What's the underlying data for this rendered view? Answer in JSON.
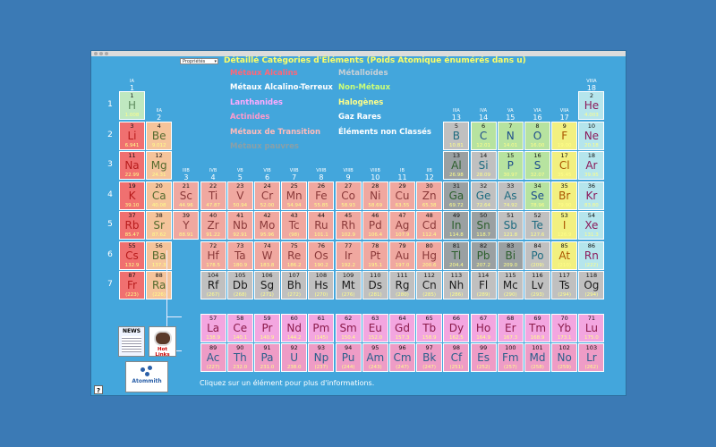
{
  "dropdown": {
    "value": "Propriétés"
  },
  "title": "Détaillé Catégories d'Éléments (Poids Atomique énumérés dans u)",
  "legend": [
    {
      "label": "Métaux Alcalins",
      "color": "#ff6677"
    },
    {
      "label": "Métaux Alcalino-Terreux",
      "color": "#ffffff"
    },
    {
      "label": "Lanthanides",
      "color": "#ffaaff"
    },
    {
      "label": "Actinides",
      "color": "#ff99cc"
    },
    {
      "label": "Métaux de Transition",
      "color": "#ffbbbb"
    },
    {
      "label": "Métaux pauvres",
      "color": "#8aa0a8"
    },
    {
      "label": "Métalloïdes",
      "color": "#c8d0d6"
    },
    {
      "label": "Non-Métaux",
      "color": "#ccff77"
    },
    {
      "label": "Halogènes",
      "color": "#ffff88"
    },
    {
      "label": "Gaz Rares",
      "color": "#ffffff"
    },
    {
      "label": "Éléments non Classés",
      "color": "#ffffff"
    }
  ],
  "groups": [
    {
      "roman": "IA",
      "arabic": "1"
    },
    {
      "roman": "IIA",
      "arabic": "2"
    },
    {
      "roman": "IIIB",
      "arabic": "3"
    },
    {
      "roman": "IVB",
      "arabic": "4"
    },
    {
      "roman": "VB",
      "arabic": "5"
    },
    {
      "roman": "VIB",
      "arabic": "6"
    },
    {
      "roman": "VIIB",
      "arabic": "7"
    },
    {
      "roman": "VIIIB",
      "arabic": "8"
    },
    {
      "roman": "VIIIB",
      "arabic": "9"
    },
    {
      "roman": "VIIIB",
      "arabic": "10"
    },
    {
      "roman": "IB",
      "arabic": "11"
    },
    {
      "roman": "IIB",
      "arabic": "12"
    },
    {
      "roman": "IIIA",
      "arabic": "13"
    },
    {
      "roman": "IVA",
      "arabic": "14"
    },
    {
      "roman": "VA",
      "arabic": "15"
    },
    {
      "roman": "VIA",
      "arabic": "16"
    },
    {
      "roman": "VIIA",
      "arabic": "17"
    },
    {
      "roman": "VIIIA",
      "arabic": "18"
    }
  ],
  "periods": [
    "1",
    "2",
    "3",
    "4",
    "5",
    "6",
    "7"
  ],
  "categories": {
    "alkali": {
      "bg": "#f07070",
      "fg": "#b71c1c"
    },
    "alkaline": {
      "bg": "#f5c49b",
      "fg": "#556b2f"
    },
    "transition": {
      "bg": "#f0a8a0",
      "fg": "#8b3a3a"
    },
    "poor": {
      "bg": "#9aa0a2",
      "fg": "#2e5f2e"
    },
    "metalloid": {
      "bg": "#c0c0c0",
      "fg": "#1e6b80"
    },
    "nonmetal": {
      "bg": "#b7e3a0",
      "fg": "#1e4d8c"
    },
    "halogen": {
      "bg": "#f2f080",
      "fg": "#aa5500"
    },
    "noble": {
      "bg": "#b5e5ec",
      "fg": "#8b1a5a"
    },
    "lanthanide": {
      "bg": "#f3a6e0",
      "fg": "#8b1a4a"
    },
    "actinide": {
      "bg": "#ee9cc6",
      "fg": "#2a5f8b"
    },
    "unknown": {
      "bg": "#c0c0c0",
      "fg": "#1c1c1c"
    },
    "hydrogen": {
      "bg": "#bfe8c0",
      "fg": "#5e8c5e"
    }
  },
  "elements": [
    {
      "z": "1",
      "s": "H",
      "w": "1.008",
      "c": "hydrogen",
      "p": 1,
      "g": 1
    },
    {
      "z": "2",
      "s": "He",
      "w": "4.003",
      "c": "noble",
      "p": 1,
      "g": 18
    },
    {
      "z": "3",
      "s": "Li",
      "w": "6.941",
      "c": "alkali",
      "p": 2,
      "g": 1
    },
    {
      "z": "4",
      "s": "Be",
      "w": "9.012",
      "c": "alkaline",
      "p": 2,
      "g": 2
    },
    {
      "z": "5",
      "s": "B",
      "w": "10.81",
      "c": "metalloid",
      "p": 2,
      "g": 13
    },
    {
      "z": "6",
      "s": "C",
      "w": "12.01",
      "c": "nonmetal",
      "p": 2,
      "g": 14
    },
    {
      "z": "7",
      "s": "N",
      "w": "14.01",
      "c": "nonmetal",
      "p": 2,
      "g": 15
    },
    {
      "z": "8",
      "s": "O",
      "w": "16.00",
      "c": "nonmetal",
      "p": 2,
      "g": 16
    },
    {
      "z": "9",
      "s": "F",
      "w": "19.00",
      "c": "halogen",
      "p": 2,
      "g": 17
    },
    {
      "z": "10",
      "s": "Ne",
      "w": "20.18",
      "c": "noble",
      "p": 2,
      "g": 18
    },
    {
      "z": "11",
      "s": "Na",
      "w": "22.99",
      "c": "alkali",
      "p": 3,
      "g": 1
    },
    {
      "z": "12",
      "s": "Mg",
      "w": "24.31",
      "c": "alkaline",
      "p": 3,
      "g": 2
    },
    {
      "z": "13",
      "s": "Al",
      "w": "26.98",
      "c": "poor",
      "p": 3,
      "g": 13
    },
    {
      "z": "14",
      "s": "Si",
      "w": "28.09",
      "c": "metalloid",
      "p": 3,
      "g": 14
    },
    {
      "z": "15",
      "s": "P",
      "w": "30.97",
      "c": "nonmetal",
      "p": 3,
      "g": 15
    },
    {
      "z": "16",
      "s": "S",
      "w": "32.07",
      "c": "nonmetal",
      "p": 3,
      "g": 16
    },
    {
      "z": "17",
      "s": "Cl",
      "w": "35.45",
      "c": "halogen",
      "p": 3,
      "g": 17
    },
    {
      "z": "18",
      "s": "Ar",
      "w": "39.95",
      "c": "noble",
      "p": 3,
      "g": 18
    },
    {
      "z": "19",
      "s": "K",
      "w": "39.10",
      "c": "alkali",
      "p": 4,
      "g": 1
    },
    {
      "z": "20",
      "s": "Ca",
      "w": "40.08",
      "c": "alkaline",
      "p": 4,
      "g": 2
    },
    {
      "z": "21",
      "s": "Sc",
      "w": "44.96",
      "c": "transition",
      "p": 4,
      "g": 3
    },
    {
      "z": "22",
      "s": "Ti",
      "w": "47.87",
      "c": "transition",
      "p": 4,
      "g": 4
    },
    {
      "z": "23",
      "s": "V",
      "w": "50.94",
      "c": "transition",
      "p": 4,
      "g": 5
    },
    {
      "z": "24",
      "s": "Cr",
      "w": "52.00",
      "c": "transition",
      "p": 4,
      "g": 6
    },
    {
      "z": "25",
      "s": "Mn",
      "w": "54.94",
      "c": "transition",
      "p": 4,
      "g": 7
    },
    {
      "z": "26",
      "s": "Fe",
      "w": "55.85",
      "c": "transition",
      "p": 4,
      "g": 8
    },
    {
      "z": "27",
      "s": "Co",
      "w": "58.93",
      "c": "transition",
      "p": 4,
      "g": 9
    },
    {
      "z": "28",
      "s": "Ni",
      "w": "58.69",
      "c": "transition",
      "p": 4,
      "g": 10
    },
    {
      "z": "29",
      "s": "Cu",
      "w": "63.55",
      "c": "transition",
      "p": 4,
      "g": 11
    },
    {
      "z": "30",
      "s": "Zn",
      "w": "65.38",
      "c": "transition",
      "p": 4,
      "g": 12
    },
    {
      "z": "31",
      "s": "Ga",
      "w": "69.72",
      "c": "poor",
      "p": 4,
      "g": 13
    },
    {
      "z": "32",
      "s": "Ge",
      "w": "72.64",
      "c": "metalloid",
      "p": 4,
      "g": 14
    },
    {
      "z": "33",
      "s": "As",
      "w": "74.92",
      "c": "metalloid",
      "p": 4,
      "g": 15
    },
    {
      "z": "34",
      "s": "Se",
      "w": "78.96",
      "c": "nonmetal",
      "p": 4,
      "g": 16
    },
    {
      "z": "35",
      "s": "Br",
      "w": "79.90",
      "c": "halogen",
      "p": 4,
      "g": 17
    },
    {
      "z": "36",
      "s": "Kr",
      "w": "83.80",
      "c": "noble",
      "p": 4,
      "g": 18
    },
    {
      "z": "37",
      "s": "Rb",
      "w": "85.47",
      "c": "alkali",
      "p": 5,
      "g": 1
    },
    {
      "z": "38",
      "s": "Sr",
      "w": "87.62",
      "c": "alkaline",
      "p": 5,
      "g": 2
    },
    {
      "z": "39",
      "s": "Y",
      "w": "88.91",
      "c": "transition",
      "p": 5,
      "g": 3
    },
    {
      "z": "40",
      "s": "Zr",
      "w": "91.22",
      "c": "transition",
      "p": 5,
      "g": 4
    },
    {
      "z": "41",
      "s": "Nb",
      "w": "92.91",
      "c": "transition",
      "p": 5,
      "g": 5
    },
    {
      "z": "42",
      "s": "Mo",
      "w": "95.96",
      "c": "transition",
      "p": 5,
      "g": 6
    },
    {
      "z": "43",
      "s": "Tc",
      "w": "(98)",
      "c": "transition",
      "p": 5,
      "g": 7
    },
    {
      "z": "44",
      "s": "Ru",
      "w": "101.1",
      "c": "transition",
      "p": 5,
      "g": 8
    },
    {
      "z": "45",
      "s": "Rh",
      "w": "102.9",
      "c": "transition",
      "p": 5,
      "g": 9
    },
    {
      "z": "46",
      "s": "Pd",
      "w": "106.4",
      "c": "transition",
      "p": 5,
      "g": 10
    },
    {
      "z": "47",
      "s": "Ag",
      "w": "107.9",
      "c": "transition",
      "p": 5,
      "g": 11
    },
    {
      "z": "48",
      "s": "Cd",
      "w": "112.4",
      "c": "transition",
      "p": 5,
      "g": 12
    },
    {
      "z": "49",
      "s": "In",
      "w": "114.8",
      "c": "poor",
      "p": 5,
      "g": 13
    },
    {
      "z": "50",
      "s": "Sn",
      "w": "118.7",
      "c": "poor",
      "p": 5,
      "g": 14
    },
    {
      "z": "51",
      "s": "Sb",
      "w": "121.8",
      "c": "metalloid",
      "p": 5,
      "g": 15
    },
    {
      "z": "52",
      "s": "Te",
      "w": "127.6",
      "c": "metalloid",
      "p": 5,
      "g": 16
    },
    {
      "z": "53",
      "s": "I",
      "w": "126.9",
      "c": "halogen",
      "p": 5,
      "g": 17
    },
    {
      "z": "54",
      "s": "Xe",
      "w": "131.3",
      "c": "noble",
      "p": 5,
      "g": 18
    },
    {
      "z": "55",
      "s": "Cs",
      "w": "132.9",
      "c": "alkali",
      "p": 6,
      "g": 1
    },
    {
      "z": "56",
      "s": "Ba",
      "w": "137.3",
      "c": "alkaline",
      "p": 6,
      "g": 2
    },
    {
      "z": "72",
      "s": "Hf",
      "w": "178.5",
      "c": "transition",
      "p": 6,
      "g": 4
    },
    {
      "z": "73",
      "s": "Ta",
      "w": "180.9",
      "c": "transition",
      "p": 6,
      "g": 5
    },
    {
      "z": "74",
      "s": "W",
      "w": "183.8",
      "c": "transition",
      "p": 6,
      "g": 6
    },
    {
      "z": "75",
      "s": "Re",
      "w": "186.2",
      "c": "transition",
      "p": 6,
      "g": 7
    },
    {
      "z": "76",
      "s": "Os",
      "w": "190.2",
      "c": "transition",
      "p": 6,
      "g": 8
    },
    {
      "z": "77",
      "s": "Ir",
      "w": "192.2",
      "c": "transition",
      "p": 6,
      "g": 9
    },
    {
      "z": "78",
      "s": "Pt",
      "w": "195.1",
      "c": "transition",
      "p": 6,
      "g": 10
    },
    {
      "z": "79",
      "s": "Au",
      "w": "197.0",
      "c": "transition",
      "p": 6,
      "g": 11
    },
    {
      "z": "80",
      "s": "Hg",
      "w": "200.6",
      "c": "transition",
      "p": 6,
      "g": 12
    },
    {
      "z": "81",
      "s": "Tl",
      "w": "204.4",
      "c": "poor",
      "p": 6,
      "g": 13
    },
    {
      "z": "82",
      "s": "Pb",
      "w": "207.2",
      "c": "poor",
      "p": 6,
      "g": 14
    },
    {
      "z": "83",
      "s": "Bi",
      "w": "209.0",
      "c": "poor",
      "p": 6,
      "g": 15
    },
    {
      "z": "84",
      "s": "Po",
      "w": "(209)",
      "c": "metalloid",
      "p": 6,
      "g": 16
    },
    {
      "z": "85",
      "s": "At",
      "w": "(210)",
      "c": "halogen",
      "p": 6,
      "g": 17
    },
    {
      "z": "86",
      "s": "Rn",
      "w": "(222)",
      "c": "noble",
      "p": 6,
      "g": 18
    },
    {
      "z": "87",
      "s": "Fr",
      "w": "(223)",
      "c": "alkali",
      "p": 7,
      "g": 1
    },
    {
      "z": "88",
      "s": "Ra",
      "w": "(226)",
      "c": "alkaline",
      "p": 7,
      "g": 2
    },
    {
      "z": "104",
      "s": "Rf",
      "w": "(267)",
      "c": "unknown",
      "p": 7,
      "g": 4
    },
    {
      "z": "105",
      "s": "Db",
      "w": "(268)",
      "c": "unknown",
      "p": 7,
      "g": 5
    },
    {
      "z": "106",
      "s": "Sg",
      "w": "(271)",
      "c": "unknown",
      "p": 7,
      "g": 6
    },
    {
      "z": "107",
      "s": "Bh",
      "w": "(272)",
      "c": "unknown",
      "p": 7,
      "g": 7
    },
    {
      "z": "108",
      "s": "Hs",
      "w": "(270)",
      "c": "unknown",
      "p": 7,
      "g": 8
    },
    {
      "z": "109",
      "s": "Mt",
      "w": "(276)",
      "c": "unknown",
      "p": 7,
      "g": 9
    },
    {
      "z": "110",
      "s": "Ds",
      "w": "(281)",
      "c": "unknown",
      "p": 7,
      "g": 10
    },
    {
      "z": "111",
      "s": "Rg",
      "w": "(280)",
      "c": "unknown",
      "p": 7,
      "g": 11
    },
    {
      "z": "112",
      "s": "Cn",
      "w": "(285)",
      "c": "unknown",
      "p": 7,
      "g": 12
    },
    {
      "z": "113",
      "s": "Nh",
      "w": "(286)",
      "c": "unknown",
      "p": 7,
      "g": 13
    },
    {
      "z": "114",
      "s": "Fl",
      "w": "(289)",
      "c": "unknown",
      "p": 7,
      "g": 14
    },
    {
      "z": "115",
      "s": "Mc",
      "w": "(290)",
      "c": "unknown",
      "p": 7,
      "g": 15
    },
    {
      "z": "116",
      "s": "Lv",
      "w": "(293)",
      "c": "unknown",
      "p": 7,
      "g": 16
    },
    {
      "z": "117",
      "s": "Ts",
      "w": "(294)",
      "c": "unknown",
      "p": 7,
      "g": 17
    },
    {
      "z": "118",
      "s": "Og",
      "w": "(294)",
      "c": "unknown",
      "p": 7,
      "g": 18
    },
    {
      "z": "57",
      "s": "La",
      "w": "138.9",
      "c": "lanthanide",
      "p": 9,
      "g": 4
    },
    {
      "z": "58",
      "s": "Ce",
      "w": "140.1",
      "c": "lanthanide",
      "p": 9,
      "g": 5
    },
    {
      "z": "59",
      "s": "Pr",
      "w": "140.9",
      "c": "lanthanide",
      "p": 9,
      "g": 6
    },
    {
      "z": "60",
      "s": "Nd",
      "w": "144.2",
      "c": "lanthanide",
      "p": 9,
      "g": 7
    },
    {
      "z": "61",
      "s": "Pm",
      "w": "(145)",
      "c": "lanthanide",
      "p": 9,
      "g": 8
    },
    {
      "z": "62",
      "s": "Sm",
      "w": "150.4",
      "c": "lanthanide",
      "p": 9,
      "g": 9
    },
    {
      "z": "63",
      "s": "Eu",
      "w": "152.0",
      "c": "lanthanide",
      "p": 9,
      "g": 10
    },
    {
      "z": "64",
      "s": "Gd",
      "w": "157.3",
      "c": "lanthanide",
      "p": 9,
      "g": 11
    },
    {
      "z": "65",
      "s": "Tb",
      "w": "158.9",
      "c": "lanthanide",
      "p": 9,
      "g": 12
    },
    {
      "z": "66",
      "s": "Dy",
      "w": "162.5",
      "c": "lanthanide",
      "p": 9,
      "g": 13
    },
    {
      "z": "67",
      "s": "Ho",
      "w": "164.9",
      "c": "lanthanide",
      "p": 9,
      "g": 14
    },
    {
      "z": "68",
      "s": "Er",
      "w": "167.3",
      "c": "lanthanide",
      "p": 9,
      "g": 15
    },
    {
      "z": "69",
      "s": "Tm",
      "w": "168.9",
      "c": "lanthanide",
      "p": 9,
      "g": 16
    },
    {
      "z": "70",
      "s": "Yb",
      "w": "173.1",
      "c": "lanthanide",
      "p": 9,
      "g": 17
    },
    {
      "z": "71",
      "s": "Lu",
      "w": "175.0",
      "c": "lanthanide",
      "p": 9,
      "g": 18
    },
    {
      "z": "89",
      "s": "Ac",
      "w": "(227)",
      "c": "actinide",
      "p": 10,
      "g": 4
    },
    {
      "z": "90",
      "s": "Th",
      "w": "232.0",
      "c": "actinide",
      "p": 10,
      "g": 5
    },
    {
      "z": "91",
      "s": "Pa",
      "w": "231.0",
      "c": "actinide",
      "p": 10,
      "g": 6
    },
    {
      "z": "92",
      "s": "U",
      "w": "238.0",
      "c": "actinide",
      "p": 10,
      "g": 7
    },
    {
      "z": "93",
      "s": "Np",
      "w": "(237)",
      "c": "actinide",
      "p": 10,
      "g": 8
    },
    {
      "z": "94",
      "s": "Pu",
      "w": "(244)",
      "c": "actinide",
      "p": 10,
      "g": 9
    },
    {
      "z": "95",
      "s": "Am",
      "w": "(243)",
      "c": "actinide",
      "p": 10,
      "g": 10
    },
    {
      "z": "96",
      "s": "Cm",
      "w": "(247)",
      "c": "actinide",
      "p": 10,
      "g": 11
    },
    {
      "z": "97",
      "s": "Bk",
      "w": "(247)",
      "c": "actinide",
      "p": 10,
      "g": 12
    },
    {
      "z": "98",
      "s": "Cf",
      "w": "(251)",
      "c": "actinide",
      "p": 10,
      "g": 13
    },
    {
      "z": "99",
      "s": "Es",
      "w": "(252)",
      "c": "actinide",
      "p": 10,
      "g": 14
    },
    {
      "z": "100",
      "s": "Fm",
      "w": "(257)",
      "c": "actinide",
      "p": 10,
      "g": 15
    },
    {
      "z": "101",
      "s": "Md",
      "w": "(258)",
      "c": "actinide",
      "p": 10,
      "g": 16
    },
    {
      "z": "102",
      "s": "No",
      "w": "(259)",
      "c": "actinide",
      "p": 10,
      "g": 17
    },
    {
      "z": "103",
      "s": "Lr",
      "w": "(262)",
      "c": "actinide",
      "p": 10,
      "g": 18
    }
  ],
  "ads": {
    "news": "NEWS",
    "hot": "Hot Links",
    "atom": "Atommith"
  },
  "footer": "Cliquez sur un élément pour plus d'informations.",
  "help": "?"
}
